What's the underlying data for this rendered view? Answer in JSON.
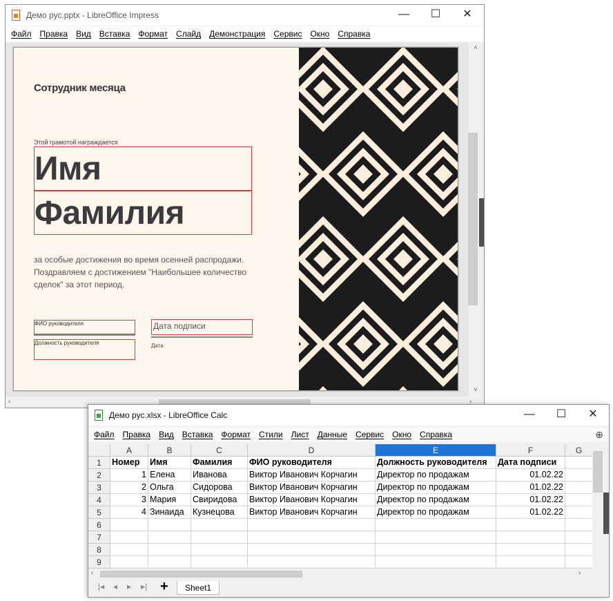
{
  "impress": {
    "title": "Демо рус.pptx - LibreOffice Impress",
    "window_buttons": [
      "—",
      "☐",
      "✕"
    ],
    "menu": [
      "Файл",
      "Правка",
      "Вид",
      "Вставка",
      "Формат",
      "Слайд",
      "Демонстрация",
      "Сервис",
      "Окно",
      "Справка"
    ],
    "slide": {
      "heading": "Сотрудник месяца",
      "award_line": "Этой грамотой награждается",
      "first_name": "Имя",
      "last_name": "Фамилия",
      "body": "за особые достижения во время осенней распродажи. Поздравляем с достижением \"Наибольшее количество сделок\" за этот период.",
      "manager_name_label": "ФИО руководителя",
      "manager_position_label": "Должность руководителя",
      "sign_date_label": "Дата подписи",
      "date_label": "Дата"
    },
    "colors": {
      "slide_bg": "#fef5ec",
      "pattern_dark": "#1c1c1c",
      "pattern_light": "#fbeedd",
      "placeholder_border": "#e23b3b"
    }
  },
  "calc": {
    "title": "Демо рус.xlsx - LibreOffice Calc",
    "window_buttons": [
      "—",
      "☐",
      "✕"
    ],
    "menu": [
      "Файл",
      "Правка",
      "Вид",
      "Вставка",
      "Формат",
      "Стили",
      "Лист",
      "Данные",
      "Сервис",
      "Окно",
      "Справка"
    ],
    "columns": [
      "A",
      "B",
      "C",
      "D",
      "E",
      "F",
      "G"
    ],
    "selected_column": "E",
    "rows": [
      "1",
      "2",
      "3",
      "4",
      "5",
      "6",
      "7",
      "8",
      "9"
    ],
    "header": [
      "Номер",
      "Имя",
      "Фамилия",
      "ФИО руководителя",
      "Должность руководителя",
      "Дата подписи"
    ],
    "data": [
      [
        "1",
        "Елена",
        "Иванова",
        "Виктор Иванович Корчагин",
        "Директор по продажам",
        "01.02.22"
      ],
      [
        "2",
        "Ольга",
        "Сидорова",
        "Виктор Иванович Корчагин",
        "Директор по продажам",
        "01.02.22"
      ],
      [
        "3",
        "Мария",
        "Свиридова",
        "Виктор Иванович Корчагин",
        "Директор по продажам",
        "01.02.22"
      ],
      [
        "4",
        "Зинаида",
        "Кузнецова",
        "Виктор Иванович Корчагин",
        "Директор по продажам",
        "01.02.22"
      ]
    ],
    "sheet_tab": "Sheet1",
    "add_sheet": "+",
    "colors": {
      "selected_header": "#1d74d4"
    }
  }
}
